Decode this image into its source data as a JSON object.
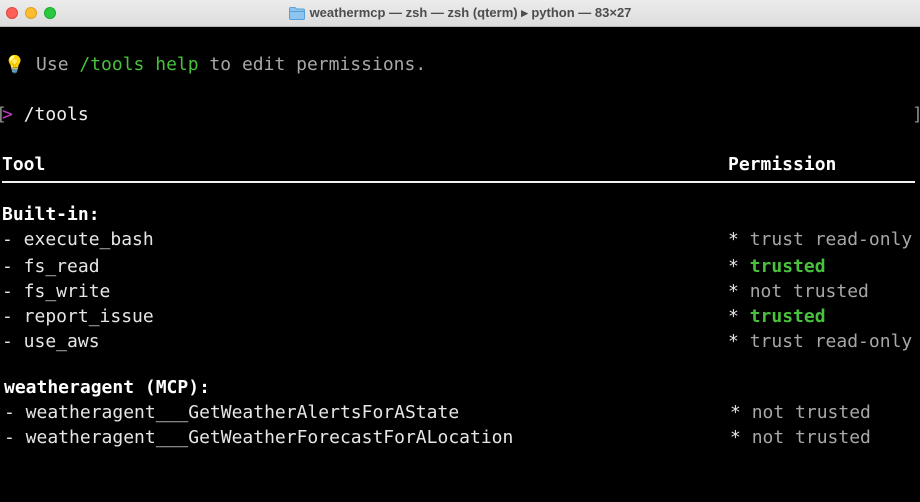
{
  "window": {
    "title": "weathermcp — zsh — zsh (qterm) ▸ python — 83×27"
  },
  "terminal": {
    "hint": {
      "icon": "💡",
      "before": "Use ",
      "command": "/tools help",
      "after": " to edit permissions."
    },
    "prompt": {
      "symbol": ">",
      "command": "/tools",
      "left_bracket": "[",
      "right_bracket": "]"
    },
    "table": {
      "col_tool": "Tool",
      "col_permission": "Permission",
      "groups": [
        {
          "heading": "Built-in:",
          "rows": [
            {
              "name": "- execute_bash",
              "star": "*",
              "permission": "trust read-only",
              "status": "read-only"
            },
            {
              "name": "- fs_read",
              "star": "*",
              "permission": "trusted",
              "status": "trusted"
            },
            {
              "name": "- fs_write",
              "star": "*",
              "permission": "not trusted",
              "status": "not-trusted"
            },
            {
              "name": "- report_issue",
              "star": "*",
              "permission": "trusted",
              "status": "trusted"
            },
            {
              "name": "- use_aws",
              "star": "*",
              "permission": "trust read-only",
              "status": "read-only"
            }
          ]
        },
        {
          "heading": "weatheragent (MCP):",
          "rows": [
            {
              "name": "- weatheragent___GetWeatherAlertsForAState",
              "star": "*",
              "permission": "not trusted",
              "status": "not-trusted"
            },
            {
              "name": "- weatheragent___GetWeatherForecastForALocation",
              "star": "*",
              "permission": "not trusted",
              "status": "not-trusted"
            }
          ]
        }
      ]
    }
  },
  "colors": {
    "trusted": "#48c23d",
    "muted": "#a7a7a7",
    "prompt_symbol": "#c53ac5"
  }
}
